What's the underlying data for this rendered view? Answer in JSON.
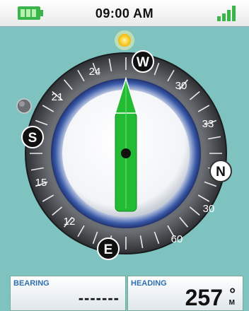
{
  "status_bar": {
    "time": "09:00 AM",
    "battery_icon": "battery-icon",
    "signal_icon": "signal-bars-icon",
    "battery_color": "#39b54a",
    "signal_color": "#39b54a"
  },
  "compass": {
    "cardinals": {
      "north": "N",
      "east": "E",
      "south": "S",
      "west": "W"
    },
    "degree_labels": [
      "24",
      "30",
      "33",
      "30",
      "60",
      "12",
      "15",
      "21"
    ],
    "needle_color": "#22bb33",
    "sun_icon": "sun-icon",
    "moon_icon": "moon-icon"
  },
  "bearing": {
    "label": "BEARING",
    "value": "-------"
  },
  "heading": {
    "label": "HEADING",
    "value": "257",
    "degree_symbol": "°",
    "unit": "M"
  },
  "colors": {
    "background": "#7fc3c0",
    "label_blue": "#2f6fb0"
  }
}
